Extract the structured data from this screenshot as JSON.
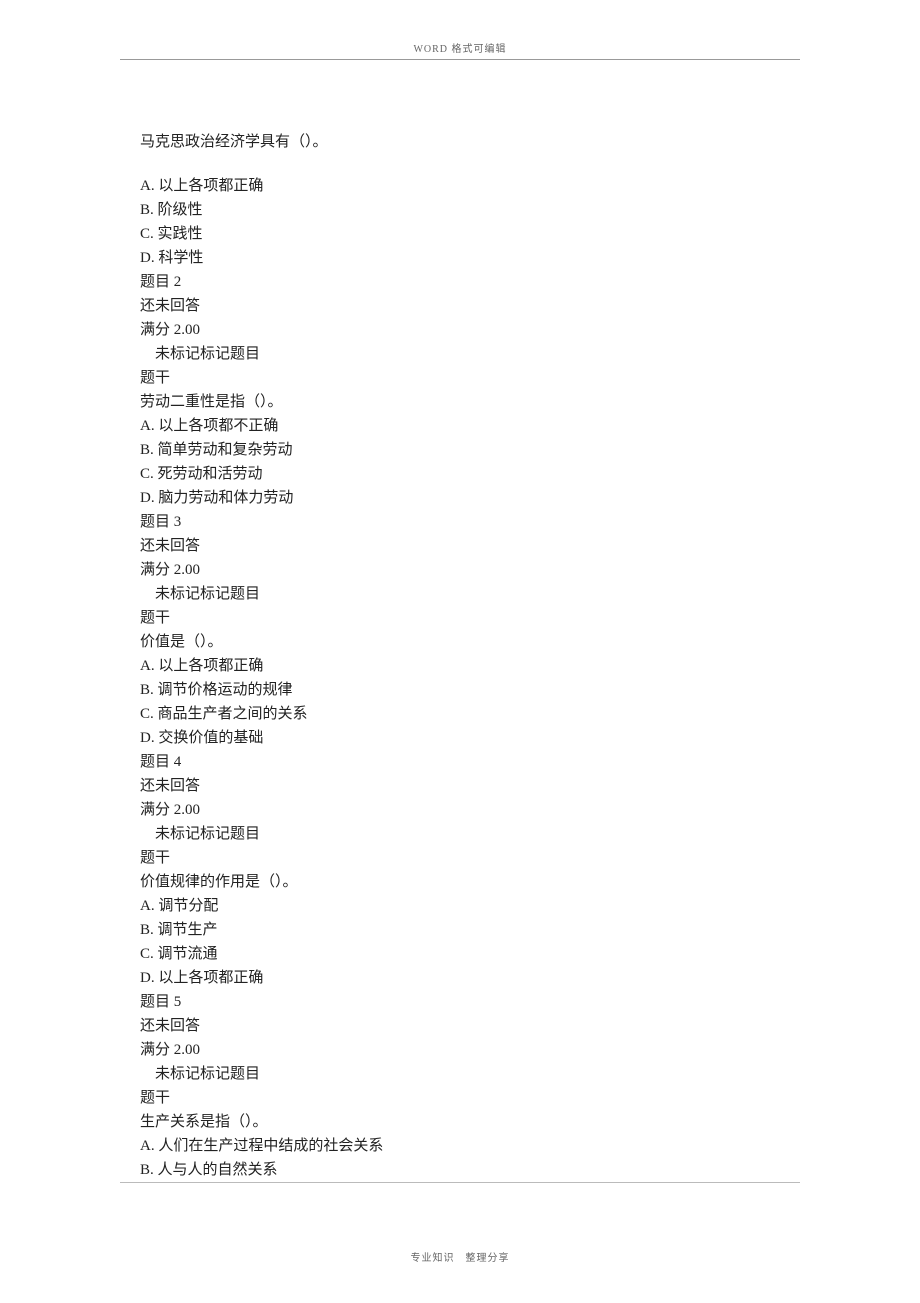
{
  "header": "WORD 格式可编辑",
  "footer": "专业知识　整理分享",
  "q1": {
    "stem": "马克思政治经济学具有（）。",
    "optA": "A. 以上各项都正确",
    "optB": "B. 阶级性",
    "optC": "C. 实践性",
    "optD": "D. 科学性"
  },
  "q2": {
    "title": "题目 2",
    "status": "还未回答",
    "score": "满分 2.00",
    "flag": "　未标记标记题目",
    "ganLabel": "题干",
    "stem": "劳动二重性是指（）。",
    "optA": "A. 以上各项都不正确",
    "optB": "B. 简单劳动和复杂劳动",
    "optC": "C. 死劳动和活劳动",
    "optD": "D. 脑力劳动和体力劳动"
  },
  "q3": {
    "title": "题目 3",
    "status": "还未回答",
    "score": "满分 2.00",
    "flag": "　未标记标记题目",
    "ganLabel": "题干",
    "stem": "价值是（）。",
    "optA": "A. 以上各项都正确",
    "optB": "B. 调节价格运动的规律",
    "optC": "C. 商品生产者之间的关系",
    "optD": "D. 交换价值的基础"
  },
  "q4": {
    "title": "题目 4",
    "status": "还未回答",
    "score": "满分 2.00",
    "flag": "　未标记标记题目",
    "ganLabel": "题干",
    "stem": "价值规律的作用是（）。",
    "optA": "A. 调节分配",
    "optB": "B. 调节生产",
    "optC": "C. 调节流通",
    "optD": "D. 以上各项都正确"
  },
  "q5": {
    "title": "题目 5",
    "status": "还未回答",
    "score": "满分 2.00",
    "flag": "　未标记标记题目",
    "ganLabel": "题干",
    "stem": "生产关系是指（）。",
    "optA": "A. 人们在生产过程中结成的社会关系",
    "optB": "B. 人与人的自然关系"
  }
}
